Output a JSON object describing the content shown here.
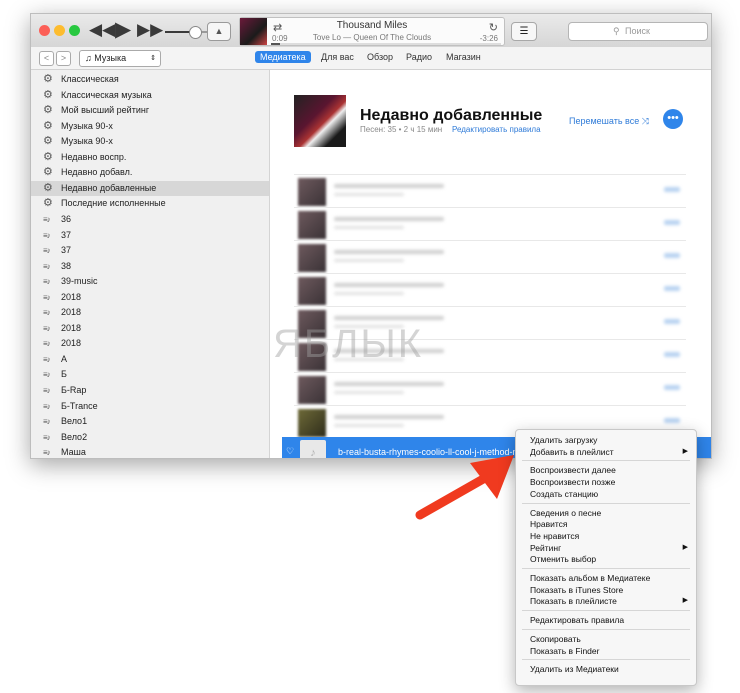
{
  "titlebar": {
    "now_playing": {
      "title": "Thousand Miles",
      "artist_album": "Tove Lo — Queen Of The Clouds",
      "elapsed": "0:09",
      "remaining": "-3:26",
      "progress": 0.04
    },
    "search_placeholder": "Поиск",
    "search_icon": "search-icon"
  },
  "navbar": {
    "source": "Музыка",
    "tabs": [
      {
        "label": "Медиатека",
        "active": true
      },
      {
        "label": "Для вас",
        "active": false
      },
      {
        "label": "Обзор",
        "active": false
      },
      {
        "label": "Радио",
        "active": false
      },
      {
        "label": "Магазин",
        "active": false
      }
    ]
  },
  "sidebar": {
    "items": [
      {
        "label": "Классическая",
        "icon": "gear-icon"
      },
      {
        "label": "Классическая музыка",
        "icon": "gear-icon"
      },
      {
        "label": "Мой высший рейтинг",
        "icon": "gear-icon"
      },
      {
        "label": "Музыка 90-х",
        "icon": "gear-icon"
      },
      {
        "label": "Музыка 90-х",
        "icon": "gear-icon"
      },
      {
        "label": "Недавно воспр.",
        "icon": "gear-icon"
      },
      {
        "label": "Недавно добавл.",
        "icon": "gear-icon"
      },
      {
        "label": "Недавно добавленные",
        "icon": "gear-icon",
        "selected": true
      },
      {
        "label": "Последние исполненные",
        "icon": "gear-icon"
      },
      {
        "label": "36",
        "icon": "playlist-icon"
      },
      {
        "label": "37",
        "icon": "playlist-icon"
      },
      {
        "label": "37",
        "icon": "playlist-icon"
      },
      {
        "label": "38",
        "icon": "playlist-icon"
      },
      {
        "label": "39-music",
        "icon": "playlist-icon"
      },
      {
        "label": "2018",
        "icon": "playlist-icon"
      },
      {
        "label": "2018",
        "icon": "playlist-icon"
      },
      {
        "label": "2018",
        "icon": "playlist-icon"
      },
      {
        "label": "2018",
        "icon": "playlist-icon"
      },
      {
        "label": "А",
        "icon": "playlist-icon"
      },
      {
        "label": "Б",
        "icon": "playlist-icon"
      },
      {
        "label": "Б-Rap",
        "icon": "playlist-icon"
      },
      {
        "label": "Б-Trance",
        "icon": "playlist-icon"
      },
      {
        "label": "Вело1",
        "icon": "playlist-icon"
      },
      {
        "label": "Вело2",
        "icon": "playlist-icon"
      },
      {
        "label": "Маша",
        "icon": "playlist-icon"
      }
    ]
  },
  "main": {
    "playlist_title": "Недавно добавленные",
    "stats": "Песен: 35 • 2 ч 15 мин",
    "edit_rules": "Редактировать правила",
    "shuffle_all": "Перемешать все",
    "more_label": "•••",
    "selected_track": "b-real-busta-rhymes-coolio-ll-cool-j-method-ma"
  },
  "watermark": "ЯБЛЫК",
  "context_menu": {
    "groups": [
      [
        {
          "label": "Удалить загрузку"
        },
        {
          "label": "Добавить в плейлист",
          "submenu": true
        }
      ],
      [
        {
          "label": "Воспроизвести далее"
        },
        {
          "label": "Воспроизвести позже"
        },
        {
          "label": "Создать станцию"
        }
      ],
      [
        {
          "label": "Сведения о песне"
        },
        {
          "label": "Нравится"
        },
        {
          "label": "Не нравится"
        },
        {
          "label": "Рейтинг",
          "submenu": true
        },
        {
          "label": "Отменить выбор"
        }
      ],
      [
        {
          "label": "Показать альбом в Медиатеке"
        },
        {
          "label": "Показать в iTunes Store"
        },
        {
          "label": "Показать в плейлисте",
          "submenu": true
        }
      ],
      [
        {
          "label": "Редактировать правила"
        }
      ],
      [
        {
          "label": "Скопировать"
        },
        {
          "label": "Показать в Finder"
        }
      ],
      [
        {
          "label": "Удалить из Медиатеки"
        }
      ]
    ]
  },
  "colors": {
    "accent": "#2f85ea",
    "arrow": "#f03a1f",
    "traffic_red": "#fc5f57",
    "traffic_yellow": "#fdbc2e",
    "traffic_green": "#28c840"
  }
}
